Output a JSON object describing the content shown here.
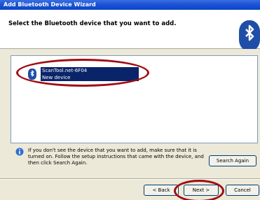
{
  "window": {
    "title": "Add Bluetooth Device Wizard"
  },
  "header": {
    "title": "Select the Bluetooth device that you want to add.",
    "icon": "bluetooth-icon"
  },
  "device_list": {
    "items": [
      {
        "name": "ScanTool.net-6F04",
        "status": "New device",
        "icon": "bluetooth-icon",
        "selected": true
      }
    ]
  },
  "info": {
    "icon": "info-icon",
    "text": "If you don't see the device that you want to add, make sure that it is turned on. Follow the setup instructions that came with the device, and then click Search Again."
  },
  "buttons": {
    "search_again": "Search Again",
    "back": "< Back",
    "next": "Next >",
    "cancel": "Cancel"
  },
  "colors": {
    "titlebar": "#1f56d8",
    "selection": "#0a246a",
    "annotation": "#a00d13",
    "bluetooth": "#1f4ea8"
  }
}
